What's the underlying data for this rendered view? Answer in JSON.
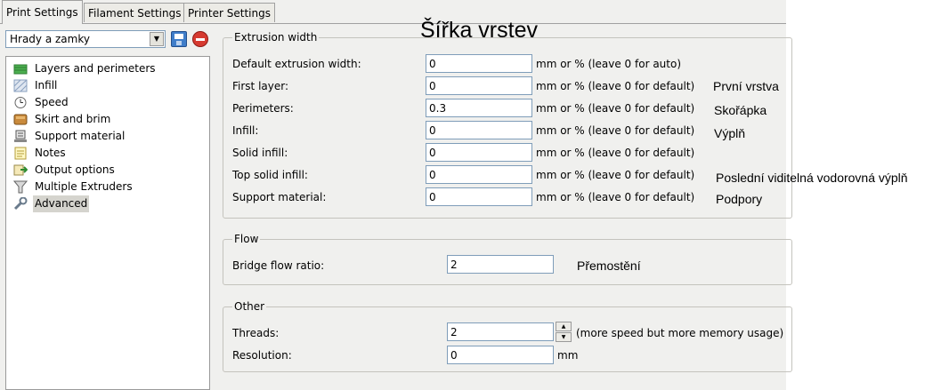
{
  "tabs": [
    {
      "label": "Print Settings",
      "active": true
    },
    {
      "label": "Filament Settings",
      "active": false
    },
    {
      "label": "Printer Settings",
      "active": false
    }
  ],
  "profile": {
    "selected": "Hrady a zamky"
  },
  "pages": [
    {
      "label": "Layers and perimeters",
      "icon": "layers-icon"
    },
    {
      "label": "Infill",
      "icon": "infill-icon"
    },
    {
      "label": "Speed",
      "icon": "clock-icon"
    },
    {
      "label": "Skirt and brim",
      "icon": "skirt-icon"
    },
    {
      "label": "Support material",
      "icon": "support-icon"
    },
    {
      "label": "Notes",
      "icon": "notes-icon"
    },
    {
      "label": "Output options",
      "icon": "output-icon"
    },
    {
      "label": "Multiple Extruders",
      "icon": "funnel-icon"
    },
    {
      "label": "Advanced",
      "icon": "wrench-icon",
      "selected": true
    }
  ],
  "heading_note": "Šířka vrstev",
  "extrusion": {
    "title": "Extrusion width",
    "rows": [
      {
        "label": "Default extrusion width:",
        "value": "0",
        "unit": "mm or % (leave 0 for auto)",
        "note": ""
      },
      {
        "label": "First layer:",
        "value": "0",
        "unit": "mm or % (leave 0 for default)",
        "note": "První vrstva"
      },
      {
        "label": "Perimeters:",
        "value": "0.3",
        "unit": "mm or % (leave 0 for default)",
        "note": "Skořápka"
      },
      {
        "label": "Infill:",
        "value": "0",
        "unit": "mm or % (leave 0 for default)",
        "note": "Výplň"
      },
      {
        "label": "Solid infill:",
        "value": "0",
        "unit": "mm or % (leave 0 for default)",
        "note": ""
      },
      {
        "label": "Top solid infill:",
        "value": "0",
        "unit": "mm or % (leave 0 for default)",
        "note": "Poslední viditelná vodorovná výplň"
      },
      {
        "label": "Support material:",
        "value": "0",
        "unit": "mm or % (leave 0 for default)",
        "note": "Podpory"
      }
    ]
  },
  "flow": {
    "title": "Flow",
    "bridge_label": "Bridge flow ratio:",
    "bridge_value": "2",
    "bridge_note": "Přemostění"
  },
  "other": {
    "title": "Other",
    "threads_label": "Threads:",
    "threads_value": "2",
    "threads_hint": "(more speed but more memory usage)",
    "resolution_label": "Resolution:",
    "resolution_value": "0",
    "resolution_unit": "mm"
  }
}
